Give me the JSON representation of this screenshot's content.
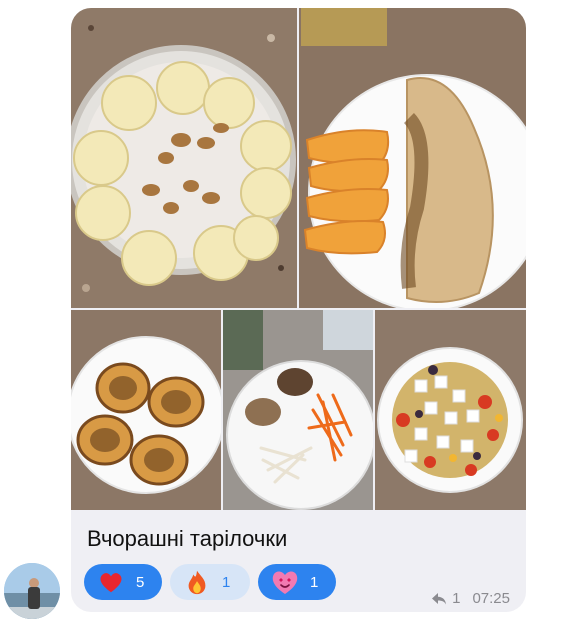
{
  "message": {
    "caption": "Вчорашні тарілочки",
    "reply_count": "1",
    "time": "07:25"
  },
  "reactions": [
    {
      "icon": "heart-icon",
      "count": "5"
    },
    {
      "icon": "fire-icon",
      "count": "1"
    },
    {
      "icon": "heart-eyes-icon",
      "count": "1"
    }
  ],
  "colors": {
    "bubble": "#efeff4",
    "reaction_active": "#2d83ef",
    "reaction_inactive": "#d7e5f7",
    "meta_text": "#8a8a8f"
  }
}
